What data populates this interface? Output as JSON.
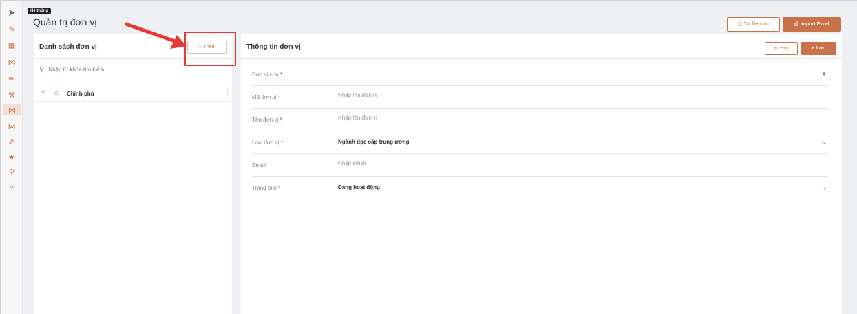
{
  "tooltip": "Hệ thống",
  "page_title": "Quản trị đơn vị",
  "header_buttons": {
    "download_template": "Tải file mẫu",
    "import_excel": "Import Excel"
  },
  "left_panel": {
    "title": "Danh sách đơn vị",
    "add_button": "Thêm",
    "search_placeholder": "Nhập từ khóa tìm kiếm",
    "tree": [
      {
        "label": "Chính phủ"
      }
    ]
  },
  "right_panel": {
    "title": "Thông tin đơn vị",
    "cancel_button": "Hủy",
    "save_button": "Lưu",
    "form": {
      "parent_unit": {
        "label": "Đơn vị cha",
        "value": ""
      },
      "unit_code": {
        "label": "Mã đơn vị",
        "placeholder": "Nhập mã đơn vị"
      },
      "unit_name": {
        "label": "Tên đơn vị",
        "placeholder": "Nhập tên đơn vị"
      },
      "unit_type": {
        "label": "Loại đơn vị",
        "value": "Ngành dọc cấp trung ương"
      },
      "email": {
        "label": "Email",
        "placeholder": "Nhập email"
      },
      "status": {
        "label": "Trạng thái",
        "value": "Đang hoạt động"
      }
    }
  },
  "colors": {
    "accent": "#c9724a",
    "highlight": "#e53935"
  }
}
